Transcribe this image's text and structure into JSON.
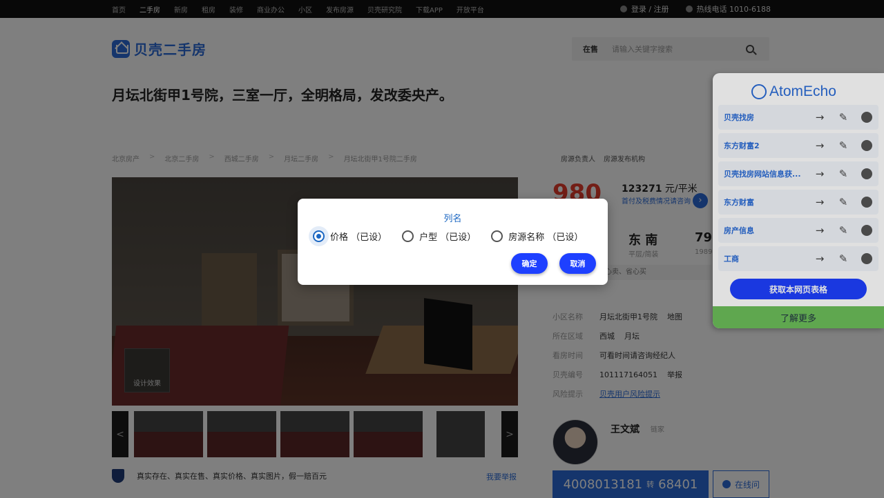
{
  "topnav": {
    "items": [
      "首页",
      "二手房",
      "新房",
      "租房",
      "装修",
      "商业办公",
      "小区",
      "发布房源",
      "贝壳研究院",
      "下载APP",
      "开放平台"
    ],
    "active_index": 1,
    "login": "登录 / 注册",
    "hotline": "热线电话 1010-6188"
  },
  "header": {
    "logo_text": "贝壳二手房",
    "search_tag": "在售",
    "search_placeholder": "请输入关键字搜索"
  },
  "listing": {
    "title": "月坛北街甲1号院，三室一厅，全明格局，发改委央产。",
    "breadcrumb": [
      "北京房产",
      "北京二手房",
      "西城二手房",
      "月坛二手房",
      "月坛北街甲1号院二手房"
    ],
    "design_label": "设计效果",
    "guarantee": "真实存在、真实在售、真实价格、真实图片，假一赔百元",
    "report_link": "我要举报",
    "prev": "<",
    "next": ">"
  },
  "info": {
    "badge_owner": "房源负责人",
    "badge_org": "房源发布机构",
    "price": "980",
    "unit_price_num": "123271",
    "unit_price_unit": "元/平米",
    "tax_link": "首付及税费情况请咨询",
    "orientation": "东 南",
    "floor_info": "平层/简装",
    "area_prefix": "79",
    "year": "1989",
    "tags_line": "心卖、省心买",
    "facts": [
      {
        "k": "小区名称",
        "v": "月坛北街甲1号院",
        "x": "地图"
      },
      {
        "k": "所在区域",
        "v": "西城",
        "x": "月坛"
      },
      {
        "k": "看房时间",
        "v": "可看时间请咨询经纪人",
        "x": ""
      },
      {
        "k": "贝壳编号",
        "v": "101117164051",
        "x": "举报"
      },
      {
        "k": "风险提示",
        "v": "贝壳用户风险提示",
        "x": ""
      }
    ],
    "agent_name": "王文斌",
    "agent_tag": "链家",
    "phone_main": "4008013181",
    "phone_sep": "转",
    "phone_ext": "68401",
    "online": "在线问"
  },
  "panel": {
    "brand": "AtomEcho",
    "items": [
      "贝壳找房",
      "东方财富2",
      "贝壳找房网站信息获...",
      "东方财富",
      "房产信息",
      "工商"
    ],
    "fetch_button": "获取本网页表格",
    "more_button": "了解更多"
  },
  "dialog": {
    "title": "列名",
    "options": [
      "价格 （已设）",
      "户型 （已设）",
      "房源名称 （已设）"
    ],
    "selected_index": 0,
    "ok": "确定",
    "cancel": "取消"
  }
}
